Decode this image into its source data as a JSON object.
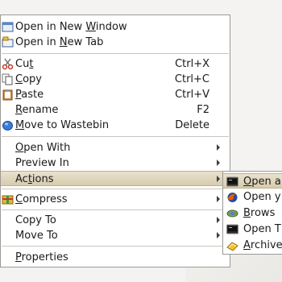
{
  "context_menu": {
    "open_new_window": {
      "pre": "Open in New ",
      "ul": "W",
      "post": "indow",
      "icon": "window-icon"
    },
    "open_new_tab": {
      "pre": "Open in ",
      "ul": "N",
      "post": "ew Tab",
      "icon": "tab-icon"
    },
    "cut": {
      "pre": "Cu",
      "ul": "t",
      "post": "",
      "accel": "Ctrl+X",
      "icon": "scissors-icon"
    },
    "copy": {
      "pre": "",
      "ul": "C",
      "post": "opy",
      "accel": "Ctrl+C",
      "icon": "copy-icon"
    },
    "paste": {
      "pre": "",
      "ul": "P",
      "post": "aste",
      "accel": "Ctrl+V",
      "icon": "clipboard-icon"
    },
    "rename": {
      "pre": "",
      "ul": "R",
      "post": "ename",
      "accel": "F2"
    },
    "move_to_wastebin": {
      "pre": "",
      "ul": "M",
      "post": "ove to Wastebin",
      "accel": "Delete",
      "icon": "trash-icon"
    },
    "open_with": {
      "pre": "",
      "ul": "O",
      "post": "pen With"
    },
    "preview_in": {
      "pre": "Preview In",
      "ul": "",
      "post": ""
    },
    "actions": {
      "pre": "Ac",
      "ul": "t",
      "post": "ions"
    },
    "compress": {
      "pre": "",
      "ul": "C",
      "post": "ompress",
      "icon": "compress-icon"
    },
    "copy_to": {
      "pre": "Copy To",
      "ul": "",
      "post": ""
    },
    "move_to": {
      "pre": "Move To",
      "ul": "",
      "post": ""
    },
    "properties": {
      "pre": "",
      "ul": "P",
      "post": "roperties"
    }
  },
  "actions_submenu": [
    {
      "pre": "",
      "ul": "O",
      "post": "pen a",
      "icon": "terminal-icon"
    },
    {
      "pre": "",
      "ul": "",
      "post": "Open y",
      "icon": "firefox-icon"
    },
    {
      "pre": "",
      "ul": "B",
      "post": "rows",
      "icon": "browse-icon"
    },
    {
      "pre": "",
      "ul": "",
      "post": "Open T",
      "icon": "terminal-icon"
    },
    {
      "pre": "",
      "ul": "A",
      "post": "rchive",
      "icon": "archive-icon"
    }
  ],
  "colors": {
    "highlight": "#dcd2b6",
    "border": "#9c9a95",
    "separator": "#c8c6c1"
  }
}
